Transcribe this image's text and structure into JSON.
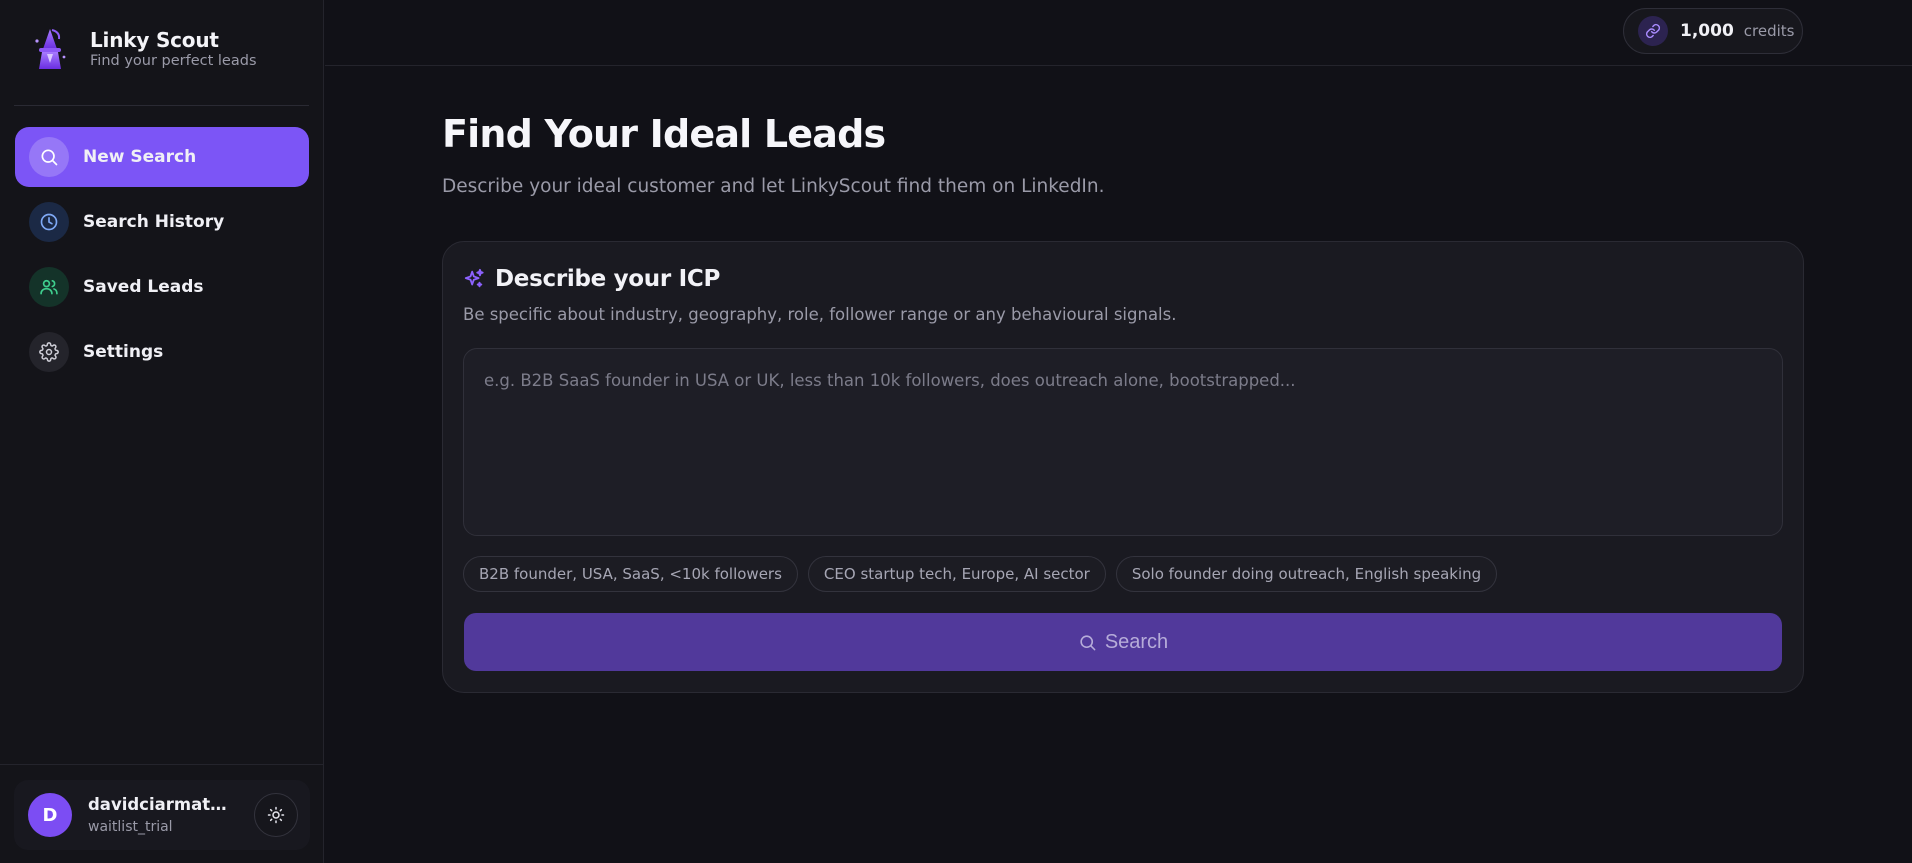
{
  "brand": {
    "title": "Linky Scout",
    "subtitle": "Find your perfect leads"
  },
  "sidebar": {
    "items": [
      {
        "label": "New Search",
        "icon": "search-icon",
        "active": true
      },
      {
        "label": "Search History",
        "icon": "clock-icon",
        "active": false
      },
      {
        "label": "Saved Leads",
        "icon": "users-icon",
        "active": false
      },
      {
        "label": "Settings",
        "icon": "gear-icon",
        "active": false
      }
    ]
  },
  "user": {
    "initial": "D",
    "name": "davidciarmatori...",
    "plan": "waitlist_trial"
  },
  "credits": {
    "value": "1,000",
    "label": "credits"
  },
  "main": {
    "title": "Find Your Ideal Leads",
    "subtitle": "Describe your ideal customer and let LinkyScout find them on LinkedIn.",
    "card": {
      "title": "Describe your ICP",
      "description": "Be specific about industry, geography, role, follower range or any behavioural signals.",
      "input_placeholder": "e.g. B2B SaaS founder in USA or UK, less than 10k followers, does outreach alone, bootstrapped...",
      "input_value": "",
      "suggestions": [
        "B2B founder, USA, SaaS, <10k followers",
        "CEO startup tech, Europe, AI sector",
        "Solo founder doing outreach, English speaking"
      ],
      "search_label": "Search"
    }
  },
  "colors": {
    "accent": "#7c55f6",
    "button": "#51399b",
    "background": "#111117"
  }
}
